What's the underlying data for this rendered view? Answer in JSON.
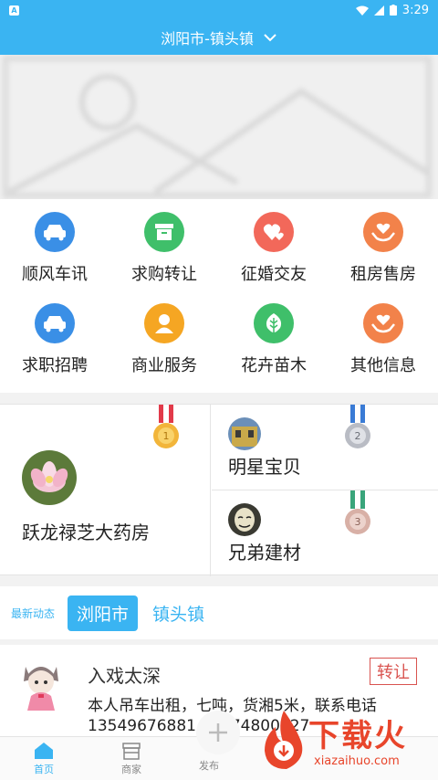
{
  "status_bar": {
    "time": "3:29"
  },
  "header": {
    "location": "浏阳市-镇头镇"
  },
  "categories": [
    {
      "label": "顺风车讯",
      "icon": "car-icon",
      "color": "#3a8fe6"
    },
    {
      "label": "求购转让",
      "icon": "box-icon",
      "color": "#3fbf6a"
    },
    {
      "label": "征婚交友",
      "icon": "hearts-icon",
      "color": "#f2685a"
    },
    {
      "label": "租房售房",
      "icon": "hand-heart-icon",
      "color": "#f2824a"
    },
    {
      "label": "求职招聘",
      "icon": "car-icon",
      "color": "#3a8fe6"
    },
    {
      "label": "商业服务",
      "icon": "person-icon",
      "color": "#f5a623"
    },
    {
      "label": "花卉苗木",
      "icon": "leaf-icon",
      "color": "#3fbf6a"
    },
    {
      "label": "其他信息",
      "icon": "hand-heart-icon",
      "color": "#f2824a"
    }
  ],
  "featured": [
    {
      "name": "跃龙禄芝大药房",
      "rank": "1"
    },
    {
      "name": "明星宝贝",
      "rank": "2"
    },
    {
      "name": "兄弟建材",
      "rank": "3"
    }
  ],
  "news": {
    "latest_label": "最新动态",
    "tabs": [
      "浏阳市",
      "镇头镇"
    ],
    "item": {
      "title": "入戏太深",
      "badge": "转让",
      "body_line1": "本人吊车出租，七吨，货湘5米，联系电话",
      "body_line2": "13549676881    18874800427"
    }
  },
  "bottom_nav": {
    "home": "首页",
    "merchant": "商家",
    "publish": "发布"
  },
  "watermark": {
    "text": "下载火",
    "url": "xiazaihuo.com"
  }
}
